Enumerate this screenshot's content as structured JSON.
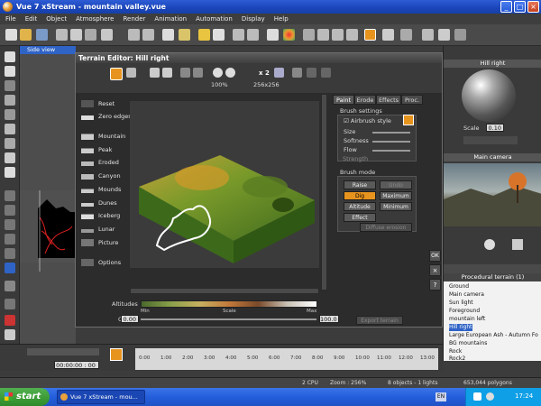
{
  "window": {
    "title": "Vue 7 xStream - mountain valley.vue"
  },
  "menu": [
    "File",
    "Edit",
    "Object",
    "Atmosphere",
    "Render",
    "Animation",
    "Automation",
    "Display",
    "Help"
  ],
  "side_view": {
    "label": "Side view"
  },
  "editor": {
    "title": "Terrain Editor: Hill right",
    "zoom": "100%",
    "multiplier": "x 2",
    "resolution": "256x256",
    "presets": [
      "Reset",
      "Zero edges",
      "Mountain",
      "Peak",
      "Eroded",
      "Canyon",
      "Mounds",
      "Dunes",
      "Iceberg",
      "Lunar",
      "Picture",
      "Options"
    ],
    "tabs": [
      "Paint",
      "Erode",
      "Effects",
      "Proc."
    ],
    "brush_settings": {
      "title": "Brush settings",
      "airbrush": "Airbrush style",
      "size": "Size",
      "softness": "Softness",
      "flow": "Flow",
      "strength": "Strength"
    },
    "brush_mode": {
      "title": "Brush mode",
      "raise": "Raise",
      "undo": "Undo",
      "dig": "Dig",
      "maximum": "Maximum",
      "altitude": "Altitude",
      "minimum": "Minimum",
      "effect": "Effect",
      "effect_select": "Diffuse erosion"
    },
    "altitudes": {
      "label": "Altitudes",
      "min": "Min",
      "scale": "Scale",
      "max": "Max"
    },
    "clip": {
      "label": "Clip",
      "min": "0.00",
      "max": "100.0"
    },
    "export": "Export terrain",
    "ok": "OK",
    "close": "×",
    "help": "?"
  },
  "right_panel": {
    "material_title": "Hill right",
    "scale_label": "Scale",
    "scale_value": "0.10",
    "camera_title": "Main camera",
    "tree_header": "Procedural terrain (1)",
    "tree": [
      "Ground",
      "Main camera",
      "Sun light",
      "Foreground",
      "mountain left",
      "Hill right",
      "Large European Ash - Autumn Fo",
      "BG mountains",
      "Rock",
      "Rock2"
    ],
    "selected_index": 5
  },
  "timeline": {
    "time": "00:00:00 : 00",
    "ticks": [
      "0:00",
      "1:00",
      "2:00",
      "3:00",
      "4:00",
      "5:00",
      "6:00",
      "7:00",
      "8:00",
      "9:00",
      "10:00",
      "11:00",
      "12:00",
      "13:00"
    ]
  },
  "status": {
    "cpu": "2 CPU",
    "zoom": "Zoom : 256%",
    "objects": "8 objects - 1 lights",
    "polygons": "653,044 polygons"
  },
  "taskbar": {
    "start": "start",
    "task": "Vue 7 xStream - mou...",
    "lang": "EN",
    "clock": "17:24"
  }
}
